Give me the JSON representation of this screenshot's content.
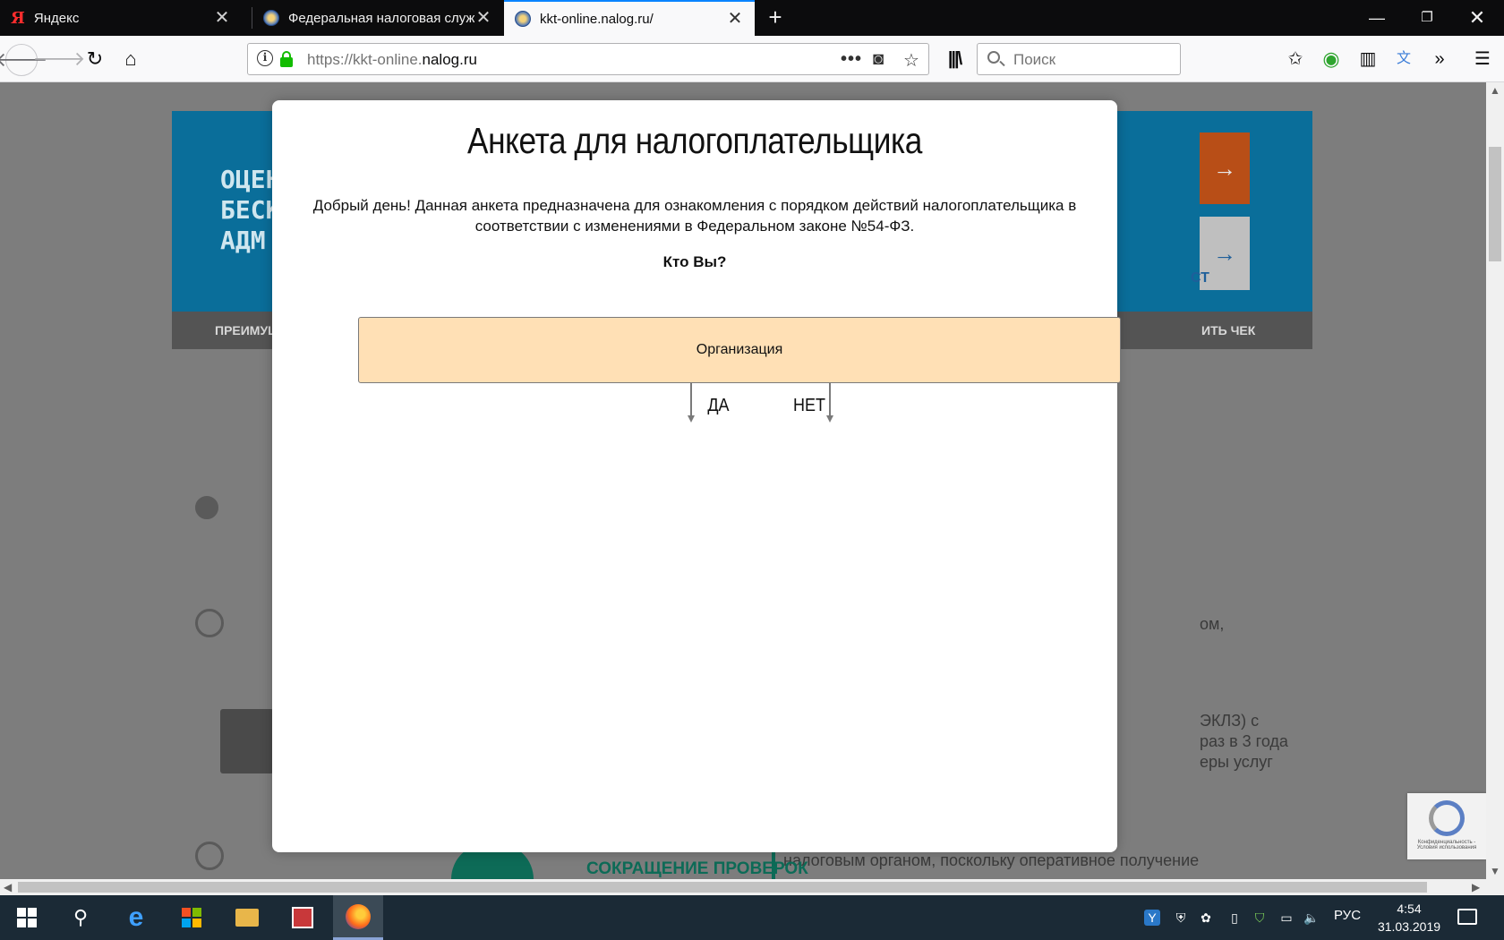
{
  "browser": {
    "tabs": [
      {
        "title": "Яндекс",
        "icon": "yandex-icon",
        "icon_glyph": "Я",
        "active": false
      },
      {
        "title": "Федеральная налоговая служба",
        "icon": "fns-emblem-icon",
        "active": false
      },
      {
        "title": "kkt-online.nalog.ru/",
        "icon": "fns-emblem-icon",
        "active": true
      }
    ],
    "url": {
      "prefix": "https://kkt-online.",
      "domain": "nalog.ru"
    },
    "search_placeholder": "Поиск",
    "accent_color": "#0a84ff"
  },
  "background_page": {
    "banner_lines": [
      "ОЦЕН",
      "БЕСК",
      "АДМ"
    ],
    "menu_left": "ПРЕИМУЩЕ",
    "menu_right": "ИТЬ ЧЕК",
    "banner_tail": "СТ",
    "text_fragments": [
      "ом,",
      "ЭКЛЗ) с",
      "раз в 3 года",
      "еры услуг",
      "налоговым органом, поскольку оперативное получение"
    ],
    "section_label": "СОКРАЩЕНИЕ ПРОВЕРОК",
    "recaptcha_text": "Конфиденциальность - Условия использования"
  },
  "modal": {
    "title": "Анкета для налогоплательщика",
    "intro": "Добрый день! Данная анкета предназначена для ознакомления с порядком действий налогоплательщика в соответствии с изменениями в Федеральном законе №54-ФЗ.",
    "question": "Кто Вы?",
    "option": "Организация",
    "option_color": "#ffe0b5",
    "yes_label": "ДА",
    "no_label": "НЕТ"
  },
  "taskbar": {
    "language": "РУС",
    "time": "4:54",
    "date": "31.03.2019"
  }
}
